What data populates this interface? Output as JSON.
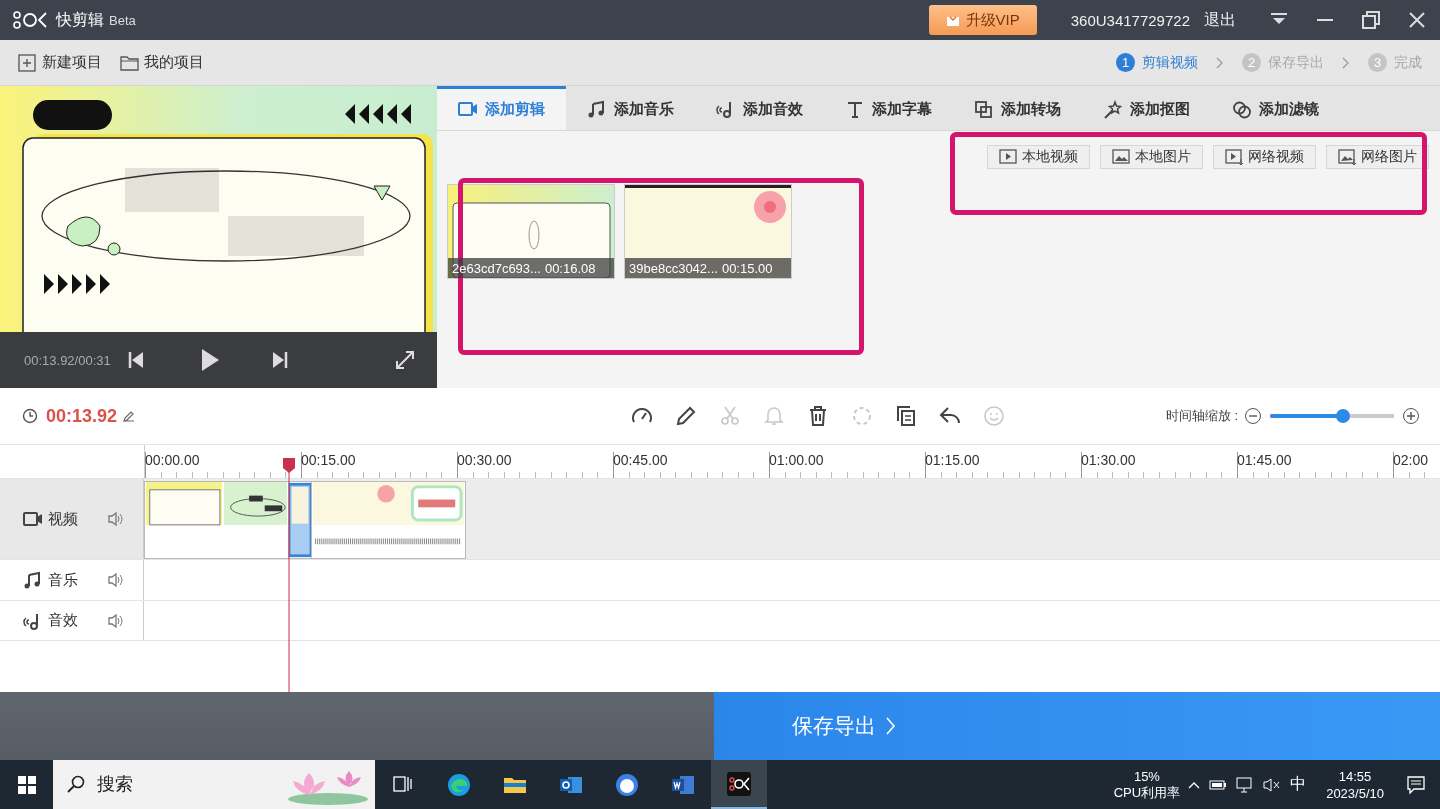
{
  "app": {
    "name": "快剪辑",
    "edition": "Beta",
    "vip_button": "升级VIP",
    "user": "360U3417729722",
    "logout": "退出"
  },
  "toolbar": {
    "actions": [
      {
        "kind": "new",
        "label": "新建项目"
      },
      {
        "kind": "open",
        "label": "我的项目"
      }
    ],
    "steps": [
      {
        "number": "1",
        "label": "剪辑视频",
        "selected": true
      },
      {
        "number": "2",
        "label": "保存导出",
        "selected": false
      },
      {
        "number": "3",
        "label": "完成",
        "selected": false
      }
    ]
  },
  "preview": {
    "time": "00:13.92/00:31"
  },
  "tabs": [
    {
      "kind": "clip",
      "label": "添加剪辑",
      "selected": true
    },
    {
      "kind": "music",
      "label": "添加音乐",
      "selected": false
    },
    {
      "kind": "sound",
      "label": "添加音效",
      "selected": false
    },
    {
      "kind": "text",
      "label": "添加字幕",
      "selected": false
    },
    {
      "kind": "transition",
      "label": "添加转场",
      "selected": false
    },
    {
      "kind": "cutout",
      "label": "添加抠图",
      "selected": false
    },
    {
      "kind": "filter",
      "label": "添加滤镜",
      "selected": false
    }
  ],
  "sources": [
    {
      "kind": "video",
      "label": "本地视频"
    },
    {
      "kind": "image",
      "label": "本地图片"
    },
    {
      "kind": "netvideo",
      "label": "网络视频"
    },
    {
      "kind": "netimage",
      "label": "网络图片"
    }
  ],
  "clips": [
    {
      "kind": "card",
      "name": "2e63cd7c693...",
      "duration": "00:16.08"
    },
    {
      "kind": "flower",
      "name": "39be8cc3042...",
      "duration": "00:15.00"
    }
  ],
  "timeline": {
    "current_time": "00:13.92",
    "zoom_label": "时间轴缩放 :",
    "zoom": {
      "level": 0.59
    },
    "tools": [
      {
        "kind": "speed",
        "disabled": false
      },
      {
        "kind": "pen",
        "disabled": false
      },
      {
        "kind": "cut",
        "disabled": true
      },
      {
        "kind": "bell",
        "disabled": true
      },
      {
        "kind": "trash",
        "disabled": false
      },
      {
        "kind": "magic",
        "disabled": true
      },
      {
        "kind": "copy",
        "disabled": false
      },
      {
        "kind": "undo",
        "disabled": false
      },
      {
        "kind": "emoji",
        "disabled": true
      }
    ],
    "ruler": [
      "00:00.00",
      "00:15.00",
      "00:30.00",
      "00:45.00",
      "01:00.00",
      "01:15.00",
      "01:30.00",
      "01:45.00",
      "02:00"
    ],
    "tracks": [
      {
        "kind": "video",
        "label": "视频"
      },
      {
        "kind": "music",
        "label": "音乐"
      },
      {
        "kind": "sound",
        "label": "音效"
      }
    ]
  },
  "export": {
    "label": "保存导出"
  },
  "taskbar": {
    "search_placeholder": "搜索",
    "cpu": "15%",
    "cpu_label": "CPU利用率",
    "ime": "中",
    "time": "14:55",
    "date": "2023/5/10"
  }
}
